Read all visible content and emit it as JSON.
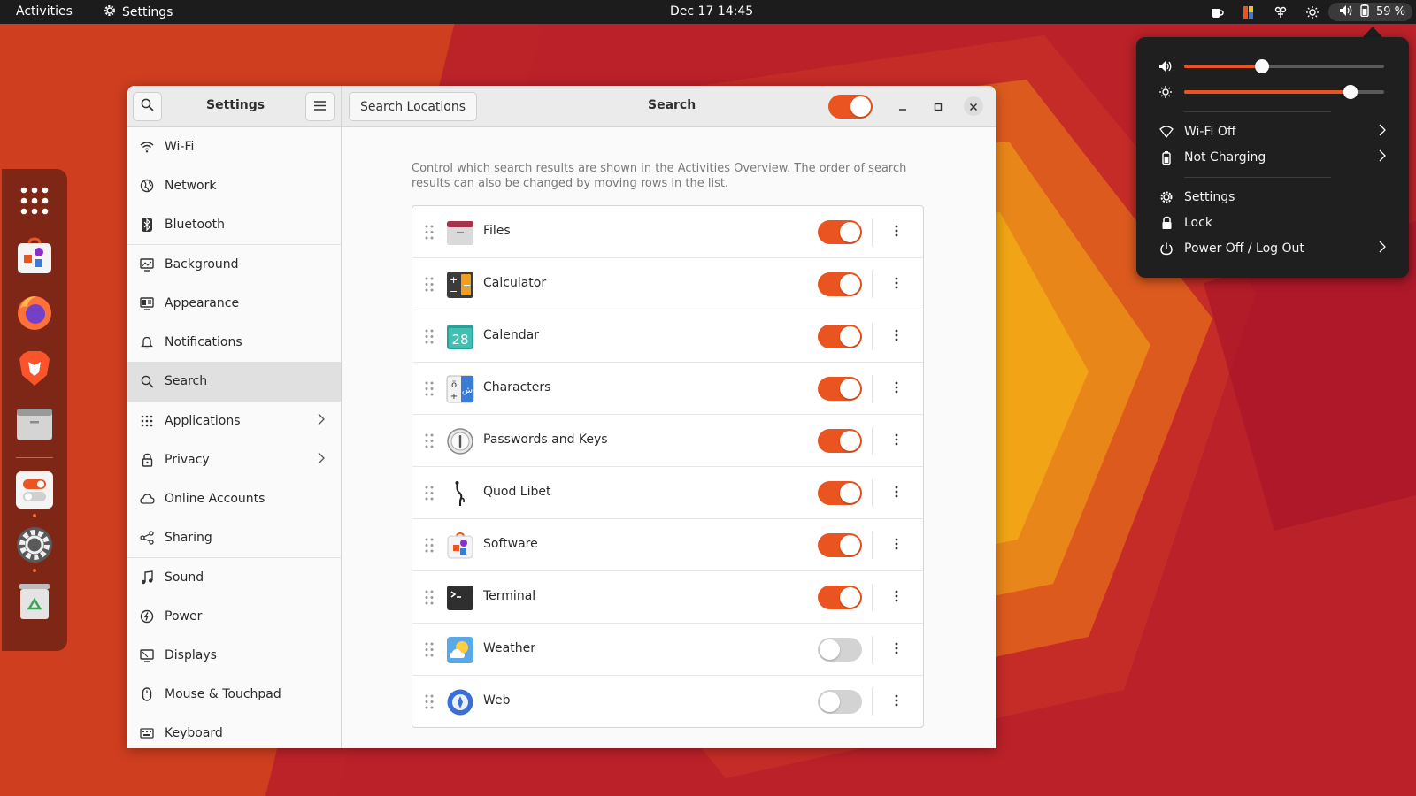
{
  "topbar": {
    "activities": "Activities",
    "app_name": "Settings",
    "clock": "Dec 17  14:45",
    "battery": "59 %"
  },
  "window": {
    "sidebar_title": "Settings",
    "search_locations": "Search Locations",
    "content_title": "Search",
    "search_enabled": true
  },
  "sidebar": {
    "items": [
      {
        "label": "Wi-Fi",
        "icon": "wifi-icon"
      },
      {
        "label": "Network",
        "icon": "globe-icon"
      },
      {
        "label": "Bluetooth",
        "icon": "bluetooth-icon"
      },
      {
        "label": "Background",
        "icon": "monitor-icon"
      },
      {
        "label": "Appearance",
        "icon": "appearance-icon"
      },
      {
        "label": "Notifications",
        "icon": "bell-icon"
      },
      {
        "label": "Search",
        "icon": "search-icon",
        "active": true
      },
      {
        "label": "Applications",
        "icon": "grid-icon",
        "chevron": true
      },
      {
        "label": "Privacy",
        "icon": "lock-icon",
        "chevron": true
      },
      {
        "label": "Online Accounts",
        "icon": "cloud-icon"
      },
      {
        "label": "Sharing",
        "icon": "share-icon"
      },
      {
        "label": "Sound",
        "icon": "music-icon"
      },
      {
        "label": "Power",
        "icon": "power-icon"
      },
      {
        "label": "Displays",
        "icon": "display-icon"
      },
      {
        "label": "Mouse & Touchpad",
        "icon": "mouse-icon"
      },
      {
        "label": "Keyboard",
        "icon": "keyboard-icon"
      }
    ]
  },
  "content": {
    "description": "Control which search results are shown in the Activities Overview. The order of search results can also be changed by moving rows in the list.",
    "providers": [
      {
        "label": "Files",
        "icon": "files-icon",
        "enabled": true
      },
      {
        "label": "Calculator",
        "icon": "calculator-icon",
        "enabled": true
      },
      {
        "label": "Calendar",
        "icon": "calendar-icon",
        "enabled": true,
        "icon_text": "28"
      },
      {
        "label": "Characters",
        "icon": "characters-icon",
        "enabled": true
      },
      {
        "label": "Passwords and Keys",
        "icon": "passwords-icon",
        "enabled": true
      },
      {
        "label": "Quod Libet",
        "icon": "quodlibet-icon",
        "enabled": true
      },
      {
        "label": "Software",
        "icon": "software-icon",
        "enabled": true
      },
      {
        "label": "Terminal",
        "icon": "terminal-icon",
        "enabled": true
      },
      {
        "label": "Weather",
        "icon": "weather-icon",
        "enabled": false
      },
      {
        "label": "Web",
        "icon": "web-icon",
        "enabled": false
      }
    ]
  },
  "quick_settings": {
    "volume": 0.39,
    "brightness": 0.83,
    "items": [
      {
        "label": "Wi-Fi Off",
        "icon": "wifi-off-icon",
        "chevron": true
      },
      {
        "label": "Not Charging",
        "icon": "battery-icon",
        "chevron": true
      },
      {
        "label": "Settings",
        "icon": "gear-icon",
        "chevron": false
      },
      {
        "label": "Lock",
        "icon": "lock-icon",
        "chevron": false
      },
      {
        "label": "Power Off / Log Out",
        "icon": "power-icon",
        "chevron": true
      }
    ]
  },
  "colors": {
    "accent": "#e95420",
    "switch_off": "#d3d3d3",
    "topbar": "#1c1c1c"
  }
}
